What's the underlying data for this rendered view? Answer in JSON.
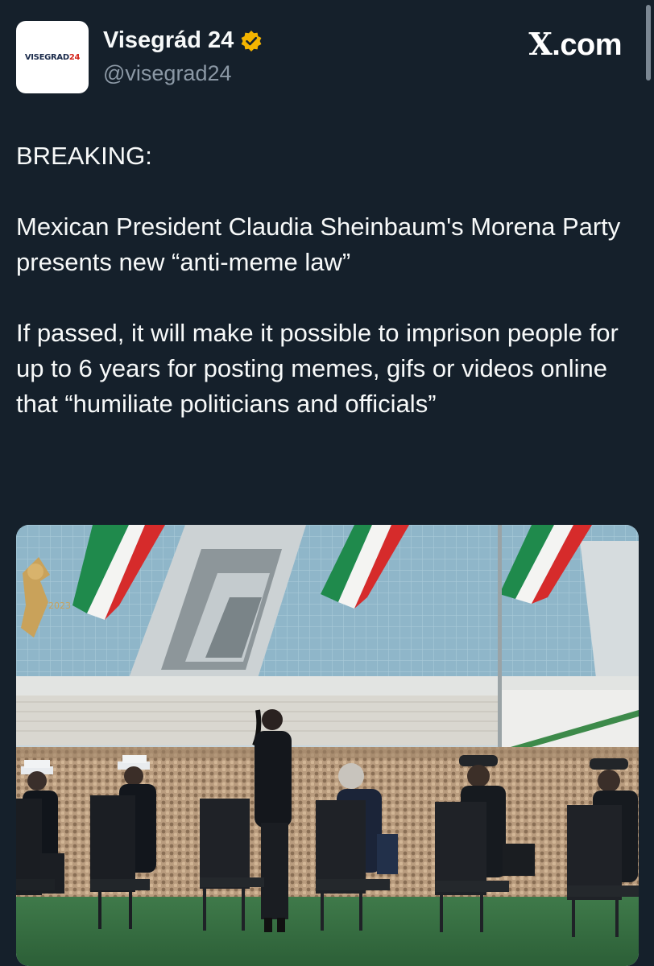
{
  "header": {
    "avatar_text": "VISEGRAD",
    "avatar_number": "24",
    "display_name": "Visegrád 24",
    "handle": "@visegrad24",
    "watermark_x": "X",
    "watermark_suffix": ".com",
    "verified_icon": "verified-badge-icon",
    "colors": {
      "verified": "#f4b400",
      "background": "#15202b",
      "handle": "#8b98a5"
    }
  },
  "post": {
    "paragraphs": [
      "BREAKING:",
      "Mexican President Claudia Sheinbaum's Morena Party presents new “anti-meme law”",
      "If passed, it will make it possible to imprison people for up to 6 years for posting memes, gifs or videos online that “humiliate politicians and officials”"
    ]
  },
  "media": {
    "emblem_year": "2023"
  }
}
